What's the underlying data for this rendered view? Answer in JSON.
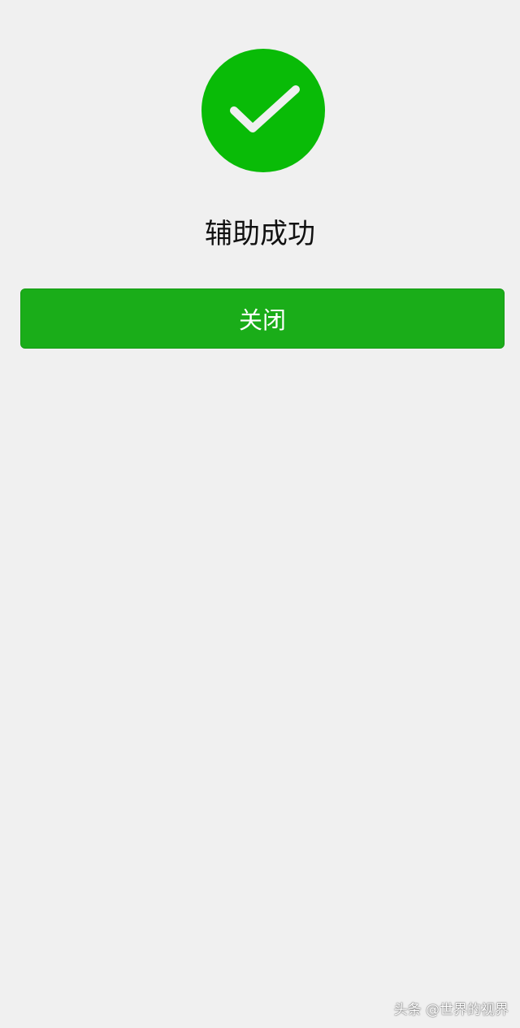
{
  "result": {
    "icon": "checkmark-circle-icon",
    "icon_color": "#09bb07",
    "title": "辅助成功"
  },
  "actions": {
    "close_label": "关闭",
    "button_color": "#1aad19"
  },
  "watermark": {
    "text": "头条 @世界的视界"
  },
  "background_color": "#f0f0f0"
}
